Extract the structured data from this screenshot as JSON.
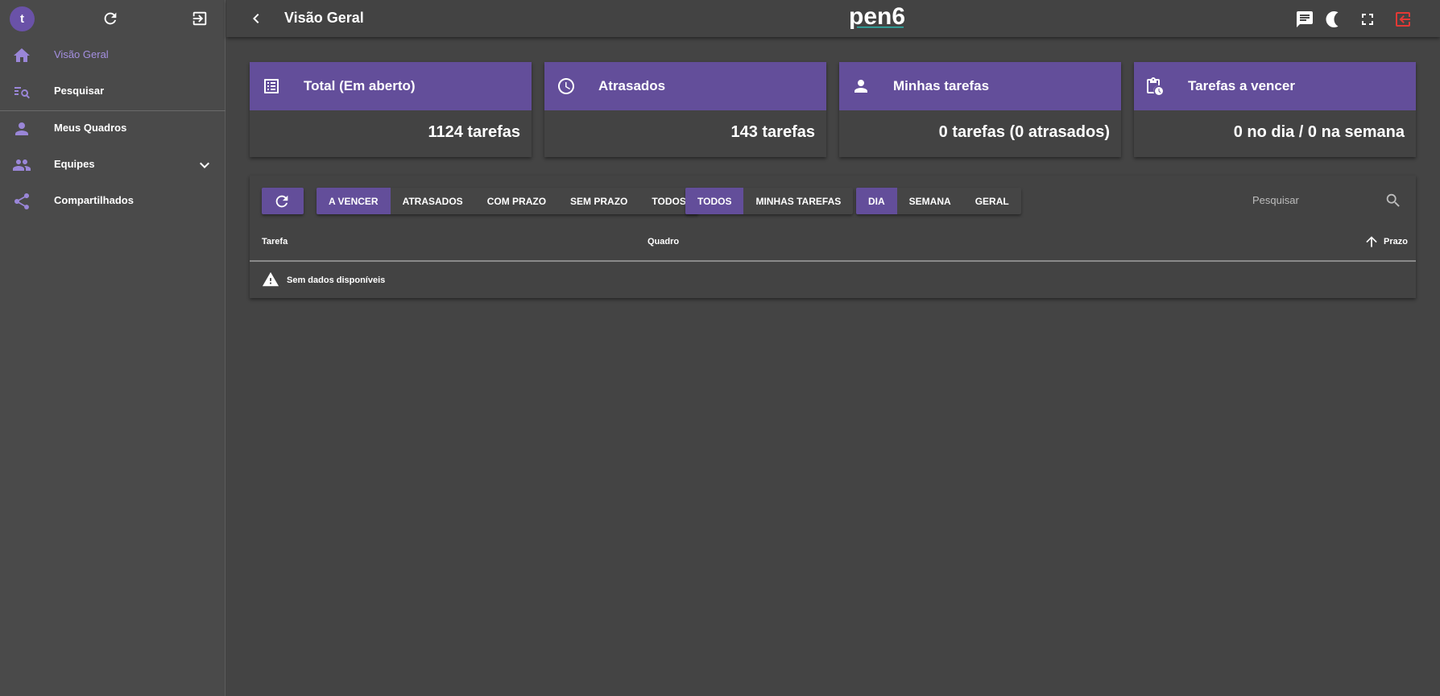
{
  "sidebar": {
    "avatar_initial": "t",
    "top_icons": [
      "refresh-icon",
      "logout-panel-icon"
    ],
    "items": [
      {
        "label": "Visão Geral",
        "icon": "home-icon",
        "active": true
      },
      {
        "label": "Pesquisar",
        "icon": "list-search-icon",
        "active": false
      },
      {
        "label": "Meus Quadros",
        "icon": "person-icon",
        "active": false
      },
      {
        "label": "Equipes",
        "icon": "group-icon",
        "active": false,
        "expandable": true
      },
      {
        "label": "Compartilhados",
        "icon": "share-icon",
        "active": false
      }
    ]
  },
  "header": {
    "title": "Visão Geral",
    "logo_text": "pen6",
    "icons": [
      "chat-icon",
      "dark-mode-icon",
      "fullscreen-icon",
      "logout-icon"
    ]
  },
  "cards": [
    {
      "title": "Total (Em aberto)",
      "value": "1124 tarefas",
      "icon": "list-icon"
    },
    {
      "title": "Atrasados",
      "value": "143 tarefas",
      "icon": "clock-icon"
    },
    {
      "title": "Minhas tarefas",
      "value": "0 tarefas (0 atrasados)",
      "icon": "person-icon"
    },
    {
      "title": "Tarefas a vencer",
      "value": "0 no dia / 0 na semana",
      "icon": "clipboard-clock-icon"
    }
  ],
  "filters": {
    "status": [
      "A VENCER",
      "ATRASADOS",
      "COM PRAZO",
      "SEM PRAZO",
      "TODOS"
    ],
    "status_selected": "A VENCER",
    "owner": [
      "TODOS",
      "MINHAS TAREFAS"
    ],
    "owner_selected": "TODOS",
    "period": [
      "DIA",
      "SEMANA",
      "GERAL"
    ],
    "period_selected": "DIA"
  },
  "search": {
    "placeholder": "Pesquisar"
  },
  "table": {
    "columns": [
      "Tarefa",
      "Quadro",
      "Prazo"
    ],
    "sort_column": "Prazo",
    "sort_direction": "asc",
    "empty_message": "Sem dados disponíveis"
  },
  "colors": {
    "accent": "#634e9a",
    "active_text": "#a48fe0",
    "logout": "#e53935",
    "logo_teal": "#2bb5ae"
  }
}
